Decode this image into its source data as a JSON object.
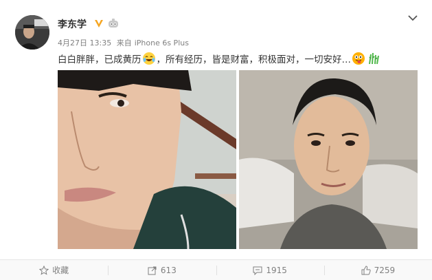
{
  "user": {
    "name": "李东学",
    "verified_badge_color": "#f5a623",
    "avatar": "avatar-photo"
  },
  "post": {
    "date": "4月27日 13:35",
    "source_prefix": "来自",
    "source": "iPhone 6s Plus",
    "text_part1": "白白胖胖，已成黄历",
    "text_part2": "，所有经历，皆是财富，积极面对，一切安好…",
    "emoji_1": "laughing-crying-emoji",
    "emoji_2": "tongue-out-emoji",
    "emoji_3": "grass-mud-horse-emoji"
  },
  "photos": [
    {
      "id": "left",
      "description_icon": "selfie-photo"
    },
    {
      "id": "right",
      "description_icon": "selfie-photo"
    }
  ],
  "actions": {
    "favorite_label": "收藏",
    "repost_count": "613",
    "comment_count": "1915",
    "like_count": "7259"
  },
  "colors": {
    "text": "#333333",
    "muted": "#808080",
    "action_bar_bg": "#f9f9f9"
  }
}
